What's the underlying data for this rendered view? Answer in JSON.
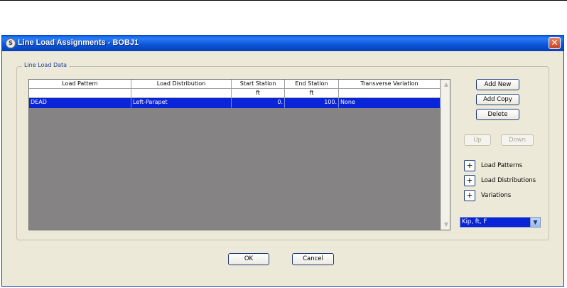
{
  "window": {
    "title": "Line Load Assignments - BOBJ1",
    "close_glyph": "✕"
  },
  "group": {
    "label": "Line Load Data"
  },
  "table": {
    "headers": [
      "Load Pattern",
      "Load Distribution",
      "Start Station",
      "End Station",
      "Transverse Variation"
    ],
    "units": [
      "",
      "",
      "ft",
      "ft",
      ""
    ],
    "rows": [
      [
        "DEAD",
        "Left-Parapet",
        "0.",
        "100.",
        "None"
      ]
    ]
  },
  "buttons": {
    "add_new": "Add New",
    "add_copy": "Add Copy",
    "delete": "Delete",
    "up": "Up",
    "down": "Down",
    "ok": "OK",
    "cancel": "Cancel"
  },
  "expanders": {
    "glyph": "+",
    "load_patterns": "Load Patterns",
    "load_distributions": "Load Distributions",
    "variations": "Variations"
  },
  "units_combo": {
    "value": "Kip, ft, F"
  },
  "colors": {
    "selection": "#0a24d8",
    "titlebar": "#0a5fe6",
    "grid_bg": "#858384"
  }
}
